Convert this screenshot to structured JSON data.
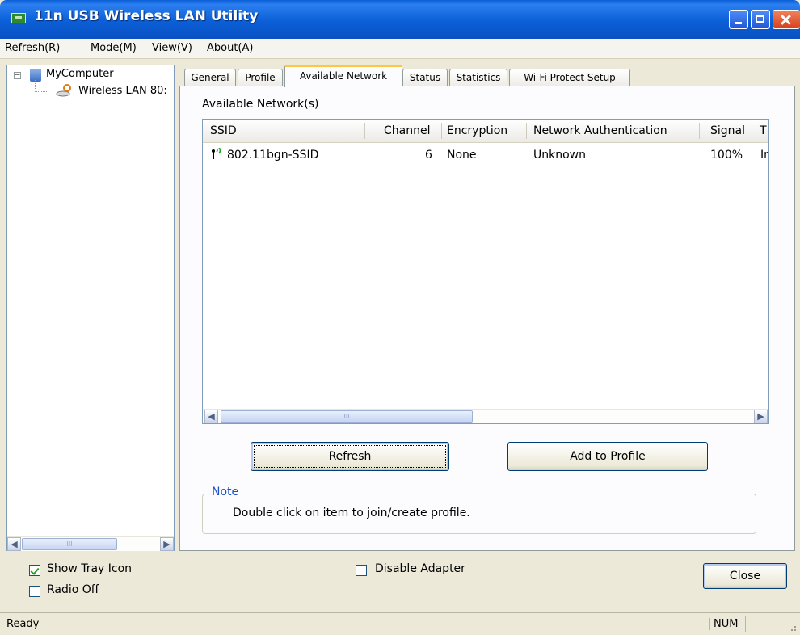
{
  "window": {
    "title": "11n USB Wireless LAN Utility"
  },
  "menu": [
    {
      "label": "Refresh(R)"
    },
    {
      "label": "Mode(M)"
    },
    {
      "label": "View(V)"
    },
    {
      "label": "About(A)"
    }
  ],
  "tree": {
    "root": "MyComputer",
    "child": "Wireless LAN 80:",
    "expander": "−"
  },
  "tabs": [
    {
      "label": "General"
    },
    {
      "label": "Profile"
    },
    {
      "label": "Available Network",
      "active": true
    },
    {
      "label": "Status"
    },
    {
      "label": "Statistics"
    },
    {
      "label": "Wi-Fi Protect Setup"
    }
  ],
  "available": {
    "heading": "Available Network(s)",
    "columns": [
      "SSID",
      "Channel",
      "Encryption",
      "Network Authentication",
      "Signal",
      "T"
    ],
    "rows": [
      {
        "ssid": "802.11bgn-SSID",
        "channel": "6",
        "encryption": "None",
        "auth": "Unknown",
        "signal": "100%",
        "type": "In"
      }
    ],
    "scroll_grip": "III"
  },
  "buttons": {
    "refresh": "Refresh",
    "add_to_profile": "Add to Profile",
    "close": "Close"
  },
  "note": {
    "title": "Note",
    "text": "Double click on item to join/create profile."
  },
  "options": {
    "show_tray_icon": {
      "label": "Show Tray Icon",
      "checked": true
    },
    "radio_off": {
      "label": "Radio Off",
      "checked": false
    },
    "disable_adapter": {
      "label": "Disable Adapter",
      "checked": false
    }
  },
  "statusbar": {
    "text": "Ready",
    "num": "NUM"
  },
  "icons": [
    "app-icon",
    "computer-icon",
    "wireless-adapter-icon",
    "signal-icon",
    "minimize-icon",
    "maximize-icon",
    "close-icon",
    "scroll-left-icon",
    "scroll-right-icon",
    "size-grip-icon"
  ],
  "colors": {
    "titlebar": "#0a5fd8",
    "note_title": "#1e51c8",
    "tab_active_highlight": "#ffc83c",
    "window_bg": "#ece9d8"
  }
}
